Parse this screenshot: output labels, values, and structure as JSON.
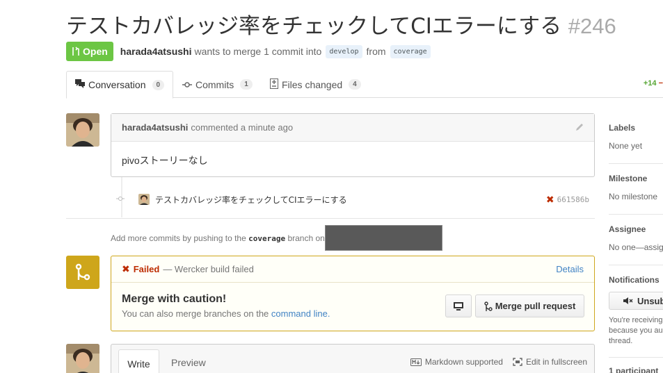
{
  "pr": {
    "title": "テストカバレッジ率をチェックしてCIエラーにする",
    "number": "#246",
    "state": "Open",
    "author": "harada4atsushi",
    "wants_text": "wants to merge 1 commit into",
    "base_branch": "develop",
    "from_text": "from",
    "head_branch": "coverage"
  },
  "tabs": [
    {
      "label": "Conversation",
      "count": "0"
    },
    {
      "label": "Commits",
      "count": "1"
    },
    {
      "label": "Files changed",
      "count": "4"
    }
  ],
  "diffstat": {
    "additions": "+14",
    "deletions": "−"
  },
  "comment": {
    "author": "harada4atsushi",
    "action": "commented a minute ago",
    "body": "pivoストーリーなし"
  },
  "commit": {
    "message": "テストカバレッジ率をチェックしてCIエラーにする",
    "sha": "661586b",
    "status": "failed"
  },
  "push_note": {
    "before": "Add more commits by pushing to the",
    "branch": "coverage",
    "after": "branch on"
  },
  "merge": {
    "status_label": "Failed",
    "status_text": "— Wercker build failed",
    "details_link": "Details",
    "title": "Merge with caution!",
    "sub_before": "You can also merge branches on the",
    "sub_link": "command line.",
    "merge_button": "Merge pull request"
  },
  "editor": {
    "write_tab": "Write",
    "preview_tab": "Preview",
    "markdown_label": "Markdown supported",
    "fullscreen_label": "Edit in fullscreen"
  },
  "sidebar": {
    "labels_title": "Labels",
    "labels_value": "None yet",
    "milestone_title": "Milestone",
    "milestone_value": "No milestone",
    "assignee_title": "Assignee",
    "assignee_value": "No one—assig",
    "notifications_title": "Notifications",
    "unsubscribe_label": "Unsub",
    "notifications_text": "You're receiving because you au thread.",
    "participants_title": "1 participant"
  },
  "colors": {
    "open_green": "#6cc644",
    "failed_red": "#bd2c00",
    "warning_yellow": "#cea61b",
    "link_blue": "#4183c4"
  }
}
